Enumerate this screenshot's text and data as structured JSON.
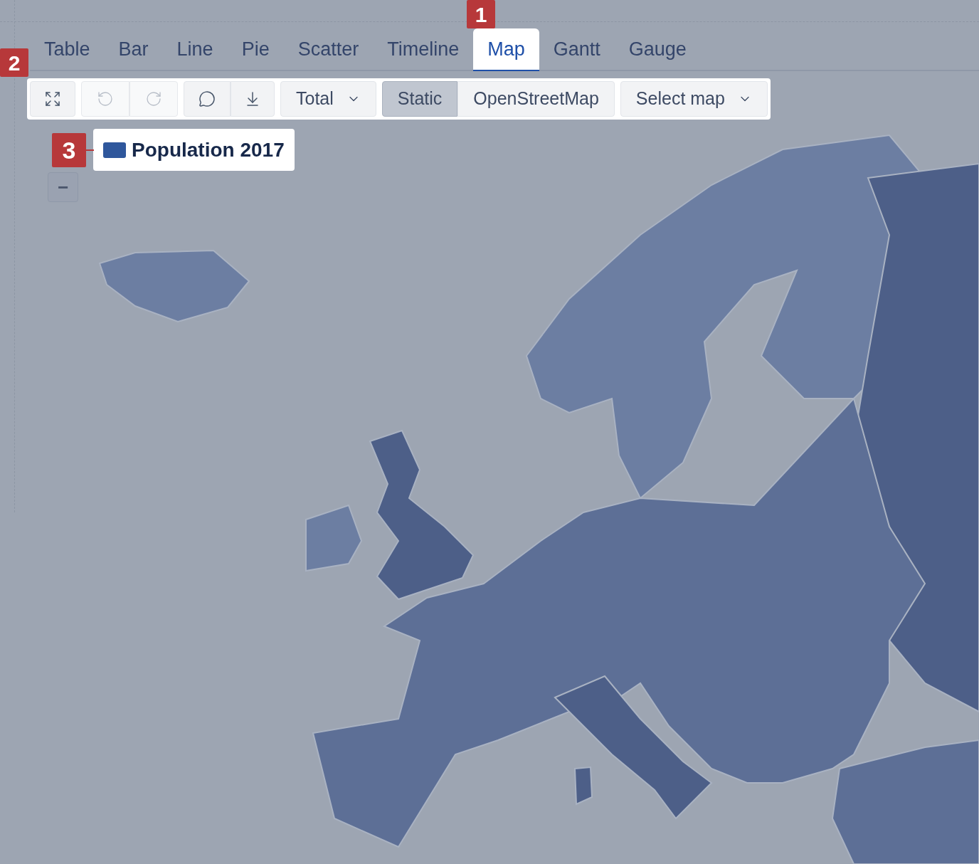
{
  "tabs": [
    {
      "label": "Table",
      "selected": false
    },
    {
      "label": "Bar",
      "selected": false
    },
    {
      "label": "Line",
      "selected": false
    },
    {
      "label": "Pie",
      "selected": false
    },
    {
      "label": "Scatter",
      "selected": false
    },
    {
      "label": "Timeline",
      "selected": false
    },
    {
      "label": "Map",
      "selected": true
    },
    {
      "label": "Gantt",
      "selected": false
    },
    {
      "label": "Gauge",
      "selected": false
    }
  ],
  "toolbar": {
    "history": [
      {
        "kind": "undo",
        "disabled": true
      },
      {
        "kind": "redo",
        "disabled": true
      }
    ],
    "aggregate": {
      "label": "Total"
    },
    "map_modes": [
      {
        "label": "Static",
        "selected": true
      },
      {
        "label": "OpenStreetMap",
        "selected": false
      }
    ],
    "select_map": {
      "label": "Select map"
    }
  },
  "zoom_out": "−",
  "legend": [
    {
      "label": "Population 2017",
      "color": "#2f579c"
    }
  ],
  "callouts": [
    {
      "number": "1"
    },
    {
      "number": "2"
    },
    {
      "number": "3"
    }
  ]
}
